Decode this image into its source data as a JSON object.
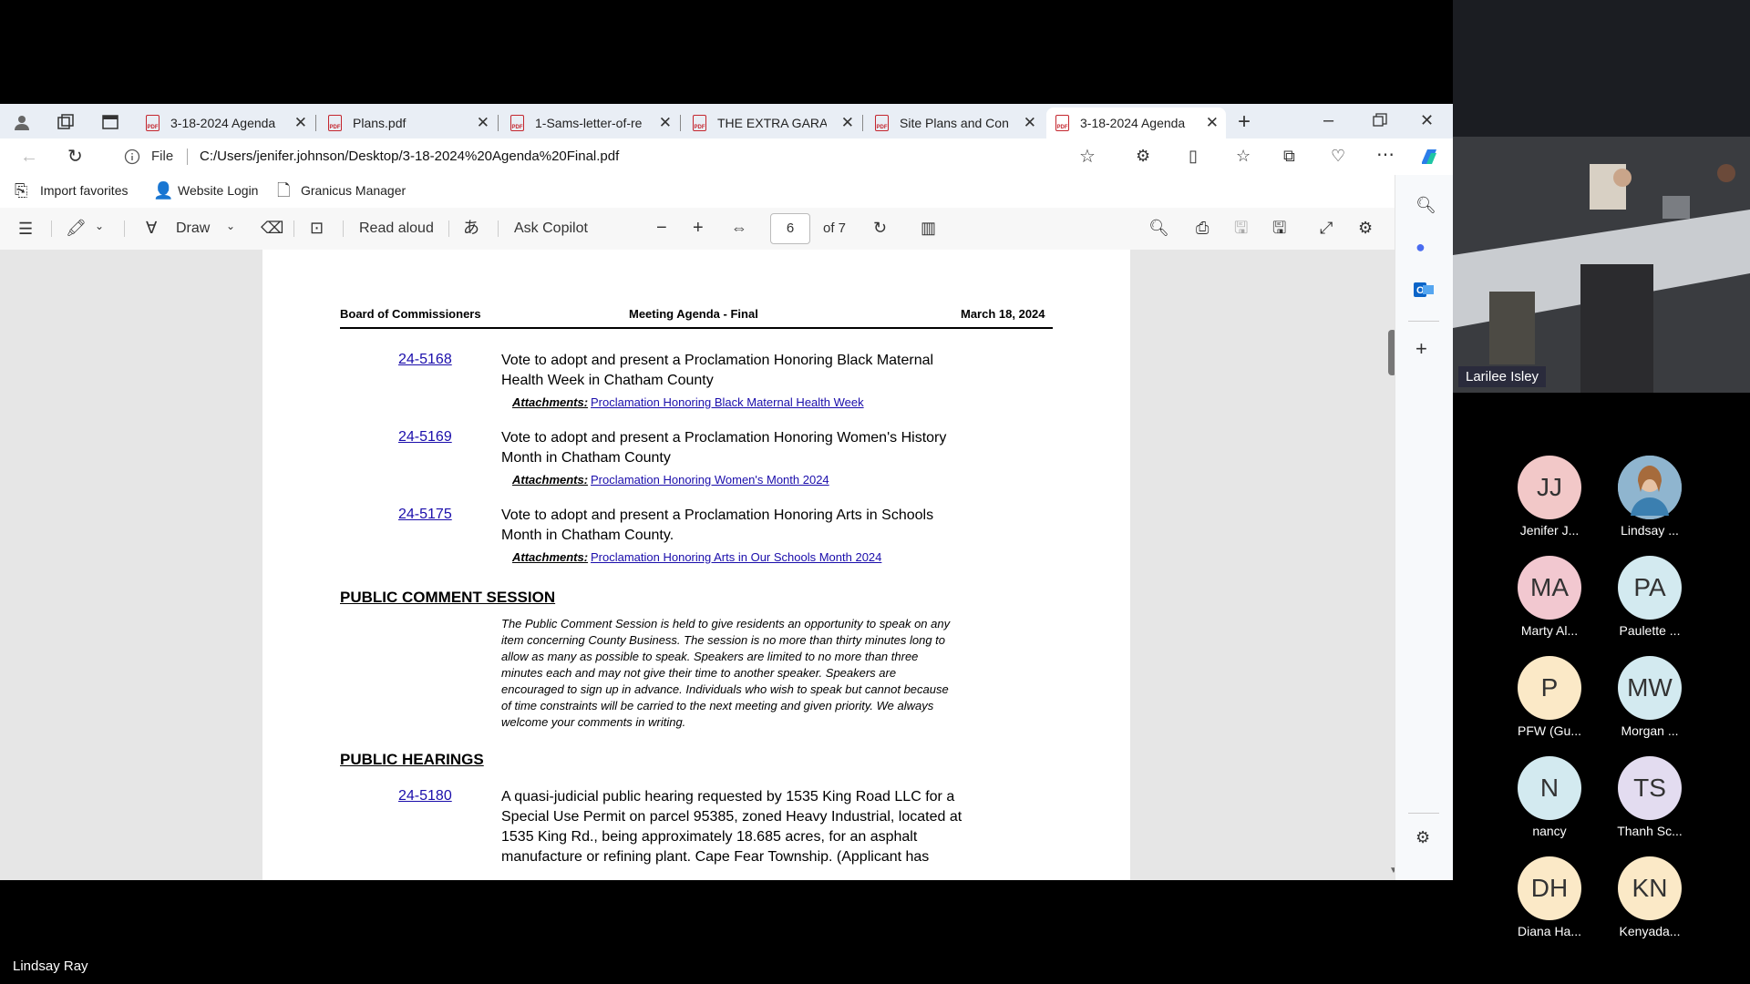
{
  "browser": {
    "tabs": [
      {
        "title": "3-18-2024 Agenda"
      },
      {
        "title": "Plans.pdf"
      },
      {
        "title": "1-Sams-letter-of-re"
      },
      {
        "title": "THE EXTRA GARAGE"
      },
      {
        "title": "Site Plans and Cons"
      },
      {
        "title": "3-18-2024 Agenda"
      }
    ],
    "address": {
      "scheme": "File",
      "url": "C:/Users/jenifer.johnson/Desktop/3-18-2024%20Agenda%20Final.pdf"
    },
    "favorites": [
      "Import favorites",
      "Website Login",
      "Granicus Manager"
    ]
  },
  "pdf_toolbar": {
    "draw": "Draw",
    "read_aloud": "Read aloud",
    "ask_copilot": "Ask Copilot",
    "page": "6",
    "of": "of 7"
  },
  "document": {
    "header_left": "Board of Commissioners",
    "header_center": "Meeting Agenda - Final",
    "header_right": "March 18, 2024",
    "items": [
      {
        "no": "24-5168",
        "line1": "Vote to adopt and present a Proclamation Honoring Black Maternal",
        "line2": "Health Week in Chatham County",
        "att_label": "Attachments:",
        "att": "Proclamation Honoring Black Maternal Health Week"
      },
      {
        "no": "24-5169",
        "line1": "Vote to adopt and present a Proclamation Honoring Women's History",
        "line2": "Month in Chatham County",
        "att_label": "Attachments:",
        "att": "Proclamation Honoring Women's Month 2024"
      },
      {
        "no": "24-5175",
        "line1": "Vote to adopt and present a Proclamation Honoring Arts in Schools",
        "line2": "Month in Chatham County.",
        "att_label": "Attachments:",
        "att": "Proclamation Honoring Arts in Our Schools Month 2024"
      }
    ],
    "public_comment_title": "PUBLIC COMMENT SESSION",
    "public_comment_text": [
      "The Public Comment Session is held to give residents an opportunity to speak on any",
      "item concerning County Business. The session is no more than thirty minutes long to",
      "allow as many as possible to speak. Speakers are limited to no more than three",
      "minutes each and may not give their time to another speaker. Speakers are",
      "encouraged to sign up in advance. Individuals who wish to speak but cannot because",
      "of time constraints will be carried to the next meeting and given priority. We always",
      "welcome your comments in writing."
    ],
    "public_hearings_title": "PUBLIC HEARINGS",
    "hearing": {
      "no": "24-5180",
      "lines": [
        "A quasi-judicial public hearing requested by 1535 King Road LLC for a",
        "Special Use Permit on parcel 95385, zoned Heavy Industrial, located at",
        "1535 King Rd., being approximately 18.685 acres, for an asphalt",
        "manufacture or refining plant. Cape Fear Township. (Applicant has"
      ]
    }
  },
  "meeting": {
    "video_label": "Larilee Isley",
    "participants": [
      {
        "initials": "JJ",
        "name": "Jenifer J...",
        "color": "#f2c8c8"
      },
      {
        "initials": "",
        "name": "Lindsay ...",
        "color": "#8fb5cf"
      },
      {
        "initials": "MA",
        "name": "Marty Al...",
        "color": "#f2c8d0"
      },
      {
        "initials": "PA",
        "name": "Paulette ...",
        "color": "#d3eaf0"
      },
      {
        "initials": "P",
        "name": "PFW (Gu...",
        "color": "#fbe9c7"
      },
      {
        "initials": "MW",
        "name": "Morgan ...",
        "color": "#d3eaf0"
      },
      {
        "initials": "N",
        "name": "nancy",
        "color": "#d3eaf0"
      },
      {
        "initials": "TS",
        "name": "Thanh Sc...",
        "color": "#e3dcf0"
      },
      {
        "initials": "DH",
        "name": "Diana Ha...",
        "color": "#fbe9c7"
      },
      {
        "initials": "KN",
        "name": "Kenyada...",
        "color": "#fbe9c7"
      }
    ],
    "speaker": "Lindsay Ray"
  }
}
